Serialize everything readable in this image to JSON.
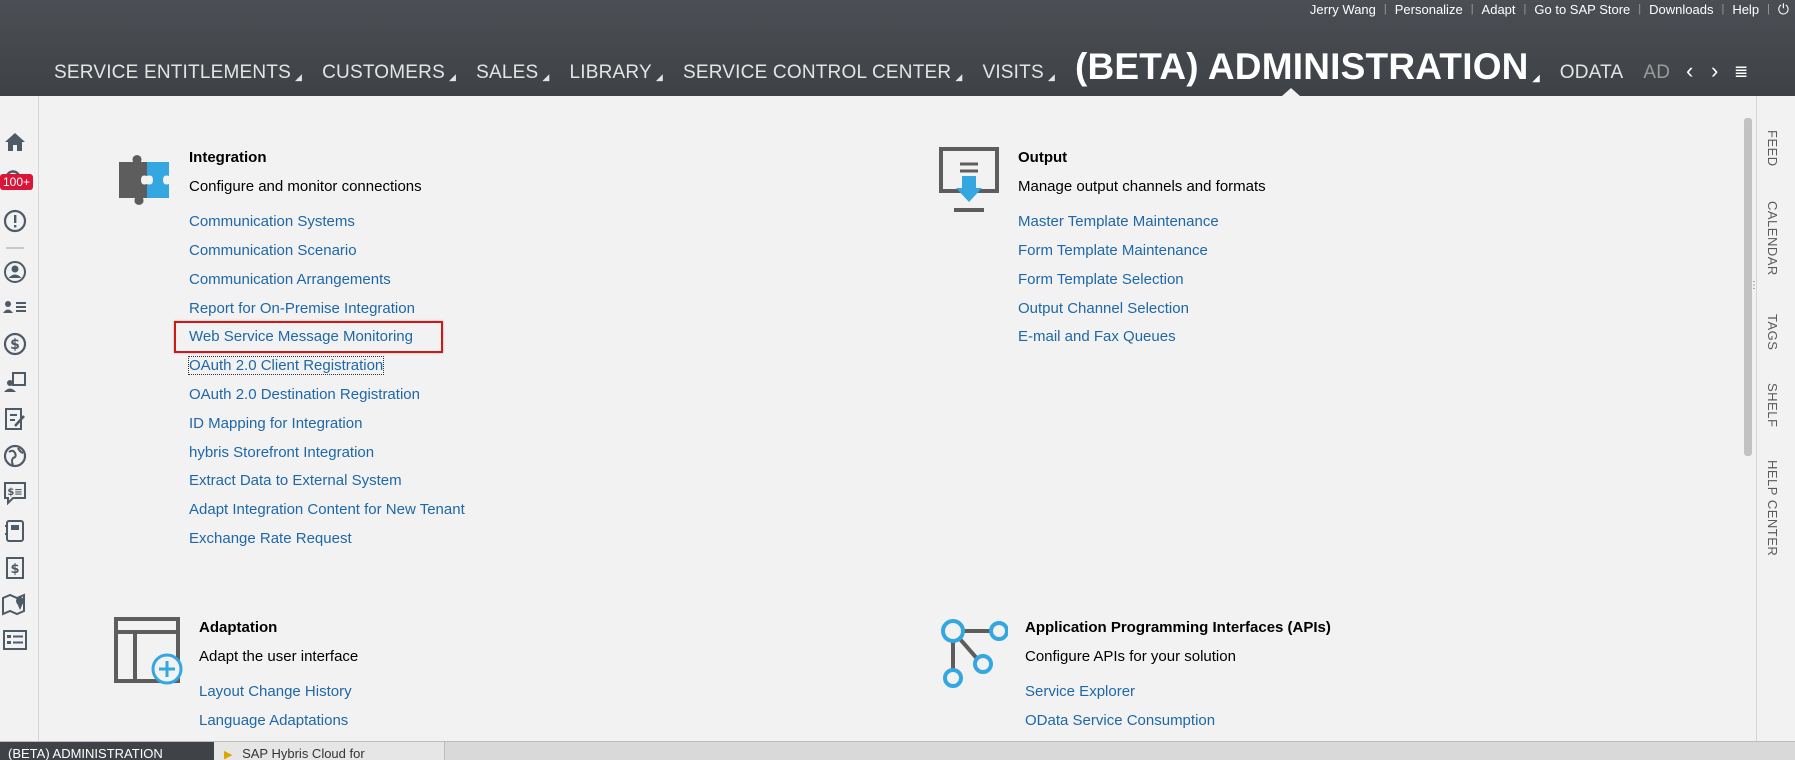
{
  "header": {
    "utility": [
      "Jerry Wang",
      "Personalize",
      "Adapt",
      "Go to SAP Store",
      "Downloads",
      "Help"
    ],
    "nav": [
      "SERVICE ENTITLEMENTS",
      "CUSTOMERS",
      "SALES",
      "LIBRARY",
      "SERVICE CONTROL CENTER",
      "VISITS",
      "(BETA) ADMINISTRATION",
      "ODATA",
      "AD"
    ]
  },
  "left_rail": {
    "badge": "100+"
  },
  "sections": {
    "integration": {
      "title": "Integration",
      "subtitle": "Configure and monitor connections",
      "links": [
        "Communication Systems",
        "Communication Scenario",
        "Communication Arrangements",
        "Report for On-Premise Integration",
        "Web Service Message Monitoring",
        "OAuth 2.0 Client Registration",
        "OAuth 2.0 Destination Registration",
        "ID Mapping for Integration",
        "hybris Storefront Integration",
        "Extract Data to External System",
        "Adapt Integration Content for New Tenant",
        "Exchange Rate Request"
      ]
    },
    "output": {
      "title": "Output",
      "subtitle": "Manage output channels and formats",
      "links": [
        "Master Template Maintenance",
        "Form Template Maintenance",
        "Form Template Selection",
        "Output Channel Selection",
        "E-mail and Fax Queues"
      ]
    },
    "adaptation": {
      "title": "Adaptation",
      "subtitle": "Adapt the user interface",
      "links": [
        "Layout Change History",
        "Language Adaptations"
      ]
    },
    "apis": {
      "title": "Application Programming Interfaces (APIs)",
      "subtitle": "Configure APIs for your solution",
      "links": [
        "Service Explorer",
        "OData Service Consumption"
      ]
    }
  },
  "right_rail": [
    "FEED",
    "CALENDAR",
    "TAGS",
    "SHELF",
    "HELP CENTER"
  ],
  "taskbar": [
    "(BETA) ADMINISTRATION",
    "SAP Hybris Cloud for"
  ],
  "colors": {
    "link": "#1e67a8",
    "highlight": "#cc1a1a",
    "header": "#45494e",
    "badge": "#d9163a"
  },
  "icons": [
    "home-icon",
    "search-icon",
    "alert-icon",
    "person-icon",
    "contacts-list-icon",
    "dollar-icon",
    "share-icon",
    "edit-icon",
    "globe-icon",
    "quote-icon",
    "document-icon",
    "invoice-icon",
    "map-icon",
    "list-icon",
    "puzzle-icon",
    "monitor-download-icon",
    "layout-add-icon",
    "api-nodes-icon",
    "power-icon"
  ]
}
